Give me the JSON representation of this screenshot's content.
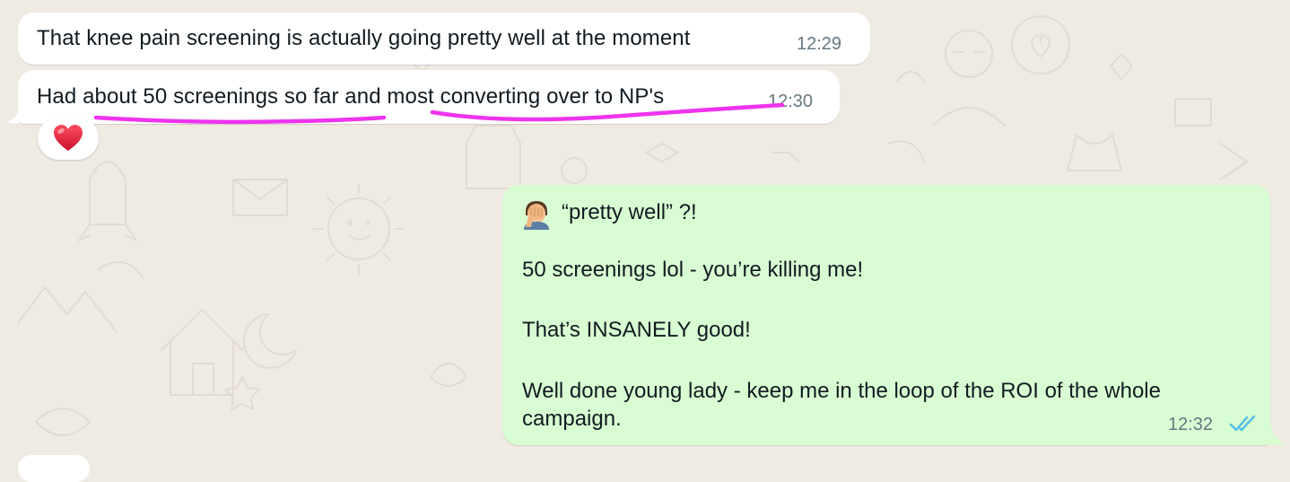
{
  "colors": {
    "background": "#efeae2",
    "incoming_bubble": "#ffffff",
    "outgoing_bubble": "#d9fdd3",
    "timestamp": "#667781",
    "read_ticks": "#53bdeb",
    "annotation_underline": "#ee33ee",
    "reaction_heart": "#e0245e"
  },
  "messages": [
    {
      "direction": "incoming",
      "text": "That knee pain screening is actually going pretty well at the moment",
      "time": "12:29"
    },
    {
      "direction": "incoming",
      "text": "Had about 50 screenings so far and most converting over to NP's",
      "time": "12:30",
      "reaction": "red-heart-emoji",
      "annotations": [
        "underline: about 50 screenings so far",
        "underline: most converting over to NP's"
      ]
    },
    {
      "direction": "outgoing",
      "emoji": "face-palm-emoji",
      "lines": [
        "“pretty well” ?!",
        "",
        "50 screenings lol - you’re killing me!",
        "",
        "That’s INSANELY good!",
        "",
        "Well done young lady - keep me in the loop of the ROI of the whole",
        "campaign."
      ],
      "time": "12:32",
      "status_icon": "double-check-read-icon"
    }
  ]
}
